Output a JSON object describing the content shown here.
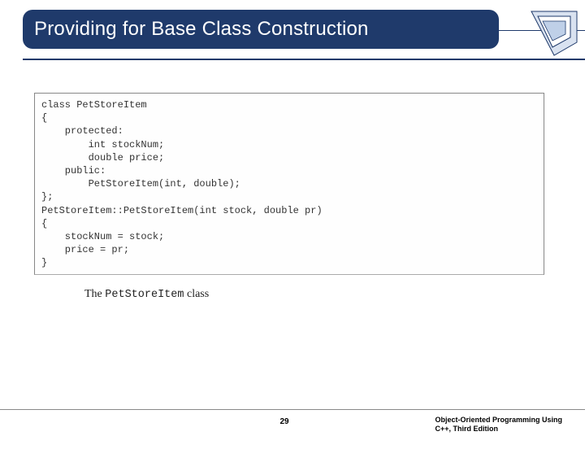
{
  "title": "Providing for Base Class Construction",
  "code": "class PetStoreItem\n{\n    protected:\n        int stockNum;\n        double price;\n    public:\n        PetStoreItem(int, double);\n};\nPetStoreItem::PetStoreItem(int stock, double pr)\n{\n    stockNum = stock;\n    price = pr;\n}",
  "caption_prefix": "The ",
  "caption_class": "PetStoreItem",
  "caption_suffix": " class",
  "page_number": "29",
  "footer_line1": "Object-Oriented Programming Using",
  "footer_line2": "C++, Third Edition"
}
